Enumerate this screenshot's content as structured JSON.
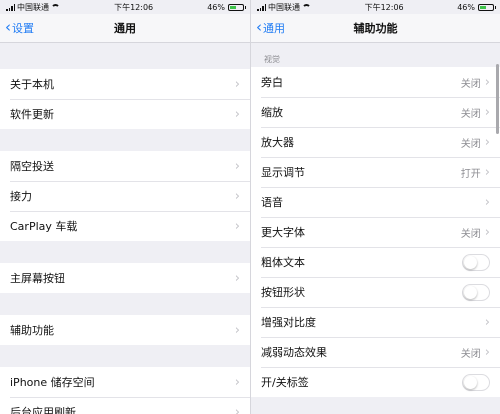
{
  "left": {
    "status": {
      "carrier": "中国联通",
      "time": "下午12:06",
      "battery": "46%"
    },
    "nav": {
      "back": "设置",
      "title": "通用"
    },
    "groups": [
      [
        "关于本机",
        "软件更新"
      ],
      [
        "隔空投送",
        "接力",
        "CarPlay 车载"
      ],
      [
        "主屏幕按钮"
      ],
      [
        "辅助功能"
      ],
      [
        "iPhone 储存空间",
        "后台应用刷新"
      ]
    ]
  },
  "right": {
    "status": {
      "carrier": "中国联通",
      "time": "下午12:06",
      "battery": "46%"
    },
    "nav": {
      "back": "通用",
      "title": "辅助功能"
    },
    "section_header": "视觉",
    "rows": [
      {
        "label": "旁白",
        "value": "关闭"
      },
      {
        "label": "缩放",
        "value": "关闭"
      },
      {
        "label": "放大器",
        "value": "关闭"
      },
      {
        "label": "显示调节",
        "value": "打开"
      },
      {
        "label": "语音",
        "value": ""
      },
      {
        "label": "更大字体",
        "value": "关闭"
      },
      {
        "label": "粗体文本",
        "toggle": false
      },
      {
        "label": "按钮形状",
        "toggle": false
      },
      {
        "label": "增强对比度",
        "value": ""
      },
      {
        "label": "减弱动态效果",
        "value": "关闭"
      },
      {
        "label": "开/关标签",
        "toggle": false
      }
    ]
  },
  "icons": {
    "back": "chevron-left-icon",
    "row": "chevron-right-icon",
    "signal": "signal-icon",
    "wifi": "wifi-icon",
    "battery": "battery-icon"
  },
  "colors": {
    "accent": "#1f7bf4",
    "battery_fill": "#3ec34a",
    "background": "#efeff4"
  },
  "battery_level": 0.46
}
